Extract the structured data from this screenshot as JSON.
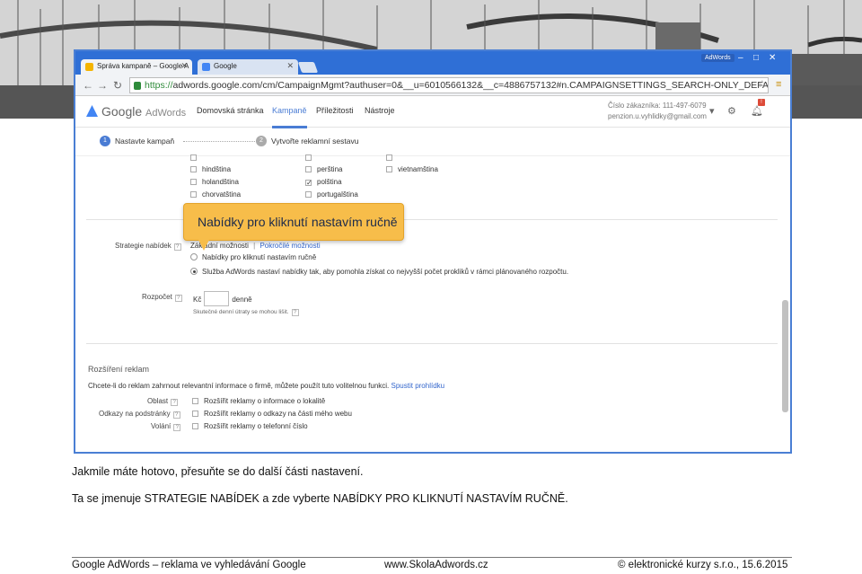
{
  "browser": {
    "tabs": [
      {
        "label": "Správa kampaně – Google A",
        "favicon_color": "#f4b400"
      },
      {
        "label": "Google",
        "favicon_color": "#4285f4"
      }
    ],
    "window_badge": "AdWords",
    "window_controls": [
      "–",
      "□",
      "✕"
    ],
    "url_scheme": "https://",
    "url_host": "adwords.google.com",
    "url_rest": "/cm/CampaignMgmt?authuser=0&__u=6010566132&__c=4886757132#n.CAMPAIGNSETTINGS_SEARCH-ONLY_DEFAULT"
  },
  "adwords": {
    "logo_google": "Google",
    "logo_adwords": "AdWords",
    "nav": [
      "Domovská stránka",
      "Kampaně",
      "Příležitosti",
      "Nástroje"
    ],
    "active_nav": "Kampaně",
    "account_number": "Číslo zákazníka: 111-497-6079",
    "account_email": "penzion.u.vyhlidky@gmail.com",
    "notification_count": "!"
  },
  "steps": [
    {
      "num": "1",
      "label": "Nastavte kampaň",
      "active": true
    },
    {
      "num": "2",
      "label": "Vytvořte reklamní sestavu",
      "active": false
    }
  ],
  "languages": {
    "col1": [
      "hindština",
      "holandština",
      "chorvatština"
    ],
    "col2": [
      "perština",
      "polština",
      "portugalština"
    ],
    "col3": [
      "vietnamština"
    ],
    "checked": "polština"
  },
  "bid_strategy": {
    "label": "Strategie nabídek",
    "basic": "Základní možnosti",
    "separator": "|",
    "advanced": "Pokročilé možnosti",
    "option_manual": "Nabídky pro kliknutí nastavím ručně",
    "option_auto": "Služba AdWords nastaví nabídky tak, aby pomohla získat co nejvyšší počet prokliků v rámci plánovaného rozpočtu.",
    "selected": "auto"
  },
  "budget": {
    "label": "Rozpočet",
    "currency": "Kč",
    "period": "denně",
    "note": "Skutečné denní útraty se mohou lišit."
  },
  "extensions": {
    "title": "Rozšíření reklam",
    "intro": "Chcete-li do reklam zahrnout relevantní informace o firmě, můžete použít tuto volitelnou funkci.",
    "intro_link": "Spustit prohlídku",
    "rows": [
      {
        "label": "Oblast",
        "text": "Rozšířit reklamy o informace o lokalitě"
      },
      {
        "label": "Odkazy na podstránky",
        "text": "Rozšířit reklamy o odkazy na části mého webu"
      },
      {
        "label": "Volání",
        "text": "Rozšířit reklamy o telefonní číslo"
      }
    ]
  },
  "callout": "Nabídky pro kliknutí nastavím ručně",
  "captions": [
    "Jakmile máte hotovo, přesuňte se do další části nastavení.",
    "Ta se jmenuje STRATEGIE NABÍDEK a zde vyberte NABÍDKY PRO KLIKNUTÍ NASTAVÍM RUČNĚ."
  ],
  "footer": {
    "left": "Google AdWords – reklama ve vyhledávání Google",
    "center": "www.SkolaAdwords.cz",
    "right": "© elektronické kurzy s.r.o., 15.6.2015"
  },
  "colors": {
    "accent": "#4a7cd4",
    "callout": "#f7bd4a",
    "browser_frame": "#2f6fd6"
  }
}
